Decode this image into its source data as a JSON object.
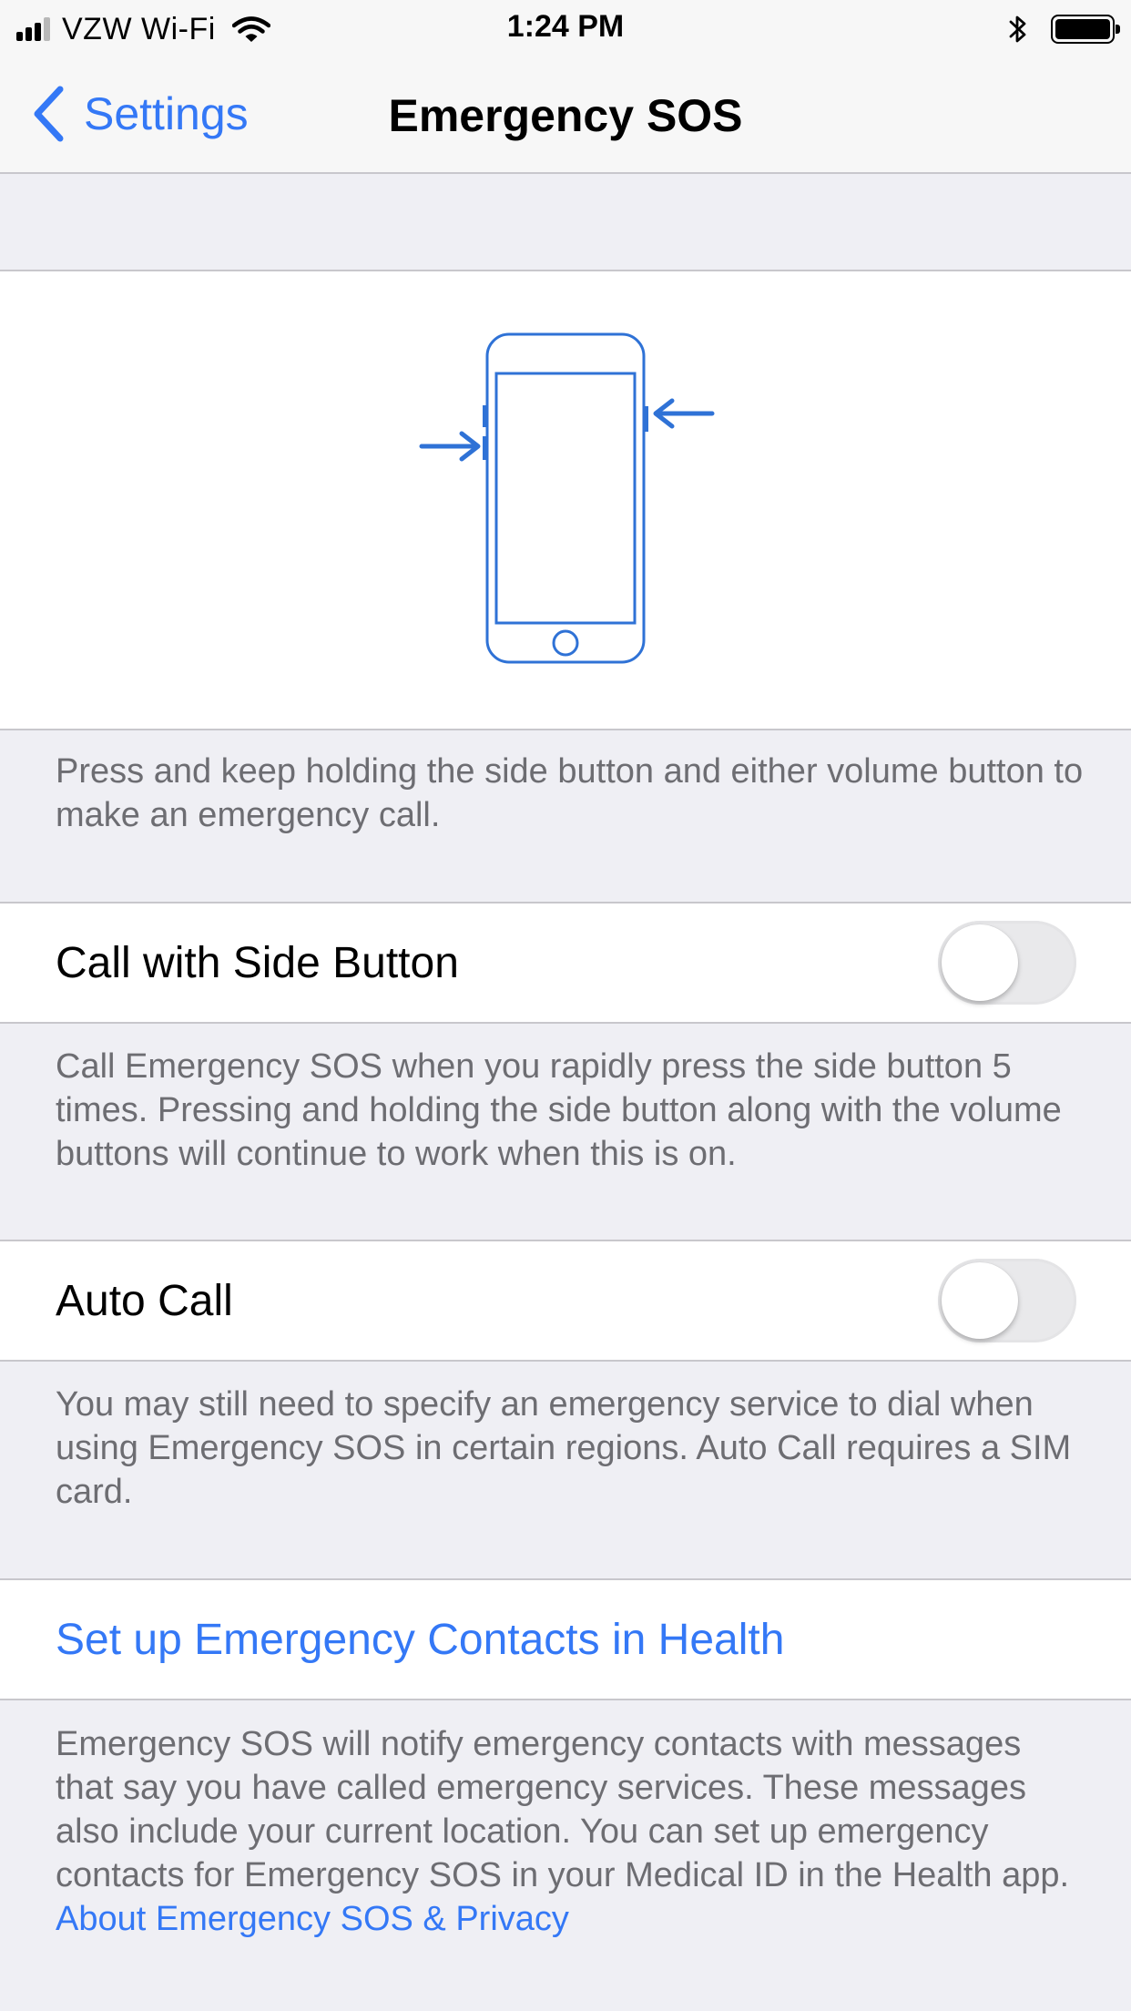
{
  "status_bar": {
    "carrier": "VZW Wi-Fi",
    "time": "1:24 PM"
  },
  "nav": {
    "back_label": "Settings",
    "title": "Emergency SOS"
  },
  "illustration": {
    "caption": "Press and keep holding the side button and either volume button to make an emergency call."
  },
  "side_button": {
    "label": "Call with Side Button",
    "enabled": false,
    "footer": "Call Emergency SOS when you rapidly press the side button 5 times. Pressing and holding the side button along with the volume buttons will continue to work when this is on."
  },
  "auto_call": {
    "label": "Auto Call",
    "enabled": false,
    "footer": "You may still need to specify an emergency service to dial when using Emergency SOS in certain regions. Auto Call requires a SIM card."
  },
  "contacts": {
    "link_label": "Set up Emergency Contacts in Health",
    "footer": "Emergency SOS will notify emergency contacts with messages that say you have called emergency services. These messages also include your current location. You can set up emergency contacts for Emergency SOS in your Medical ID in the Health app.",
    "privacy_link": "About Emergency SOS & Privacy"
  },
  "colors": {
    "accent": "#3478f6",
    "group_background": "#efeff4",
    "separator": "#c8c7cc",
    "footer_text": "#6d6d72"
  },
  "icons": [
    "signal-bars-icon",
    "wifi-icon",
    "bluetooth-icon",
    "battery-icon",
    "chevron-left-icon",
    "phone-buttons-illustration"
  ]
}
